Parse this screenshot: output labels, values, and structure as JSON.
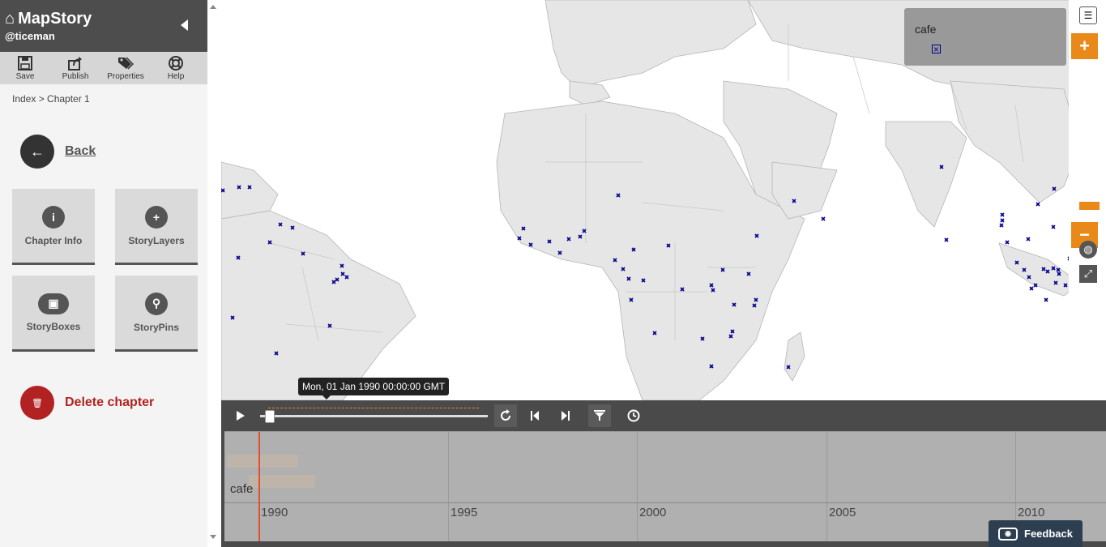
{
  "app": {
    "title": "MapStory",
    "user": "@ticeman"
  },
  "toolbar": [
    {
      "label": "Save",
      "icon": "save-icon"
    },
    {
      "label": "Publish",
      "icon": "publish-icon"
    },
    {
      "label": "Properties",
      "icon": "tags-icon"
    },
    {
      "label": "Help",
      "icon": "lifebuoy-icon"
    }
  ],
  "breadcrumb": "Index > Chapter 1",
  "back_label": "Back",
  "cards": [
    {
      "label": "Chapter Info",
      "icon": "i"
    },
    {
      "label": "StoryLayers",
      "icon": "+"
    },
    {
      "label": "StoryBoxes",
      "icon": "▣"
    },
    {
      "label": "StoryPins",
      "icon": "⚲"
    }
  ],
  "delete_label": "Delete chapter",
  "legend": {
    "title": "cafe"
  },
  "playback": {
    "tooltip": "Mon, 01 Jan 1990 00:00:00 GMT"
  },
  "timeline": {
    "layer": "cafe",
    "years": [
      "1990",
      "1995",
      "2000",
      "2005",
      "2010"
    ]
  },
  "feedback_label": "Feedback",
  "colors": {
    "accent": "#e8891a",
    "marker": "#00008b",
    "danger": "#b22222"
  }
}
